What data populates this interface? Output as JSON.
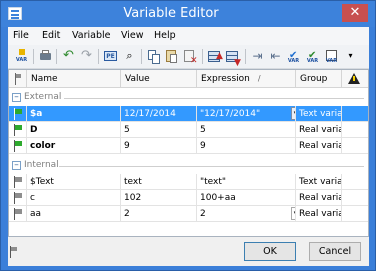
{
  "window": {
    "title": "Variable Editor",
    "close_glyph": "✕"
  },
  "menu": [
    "File",
    "Edit",
    "Variable",
    "View",
    "Help"
  ],
  "toolbar": {
    "var_label": "VAR",
    "icons": [
      "new-variable-icon",
      "print-icon",
      "undo-icon",
      "redo-icon",
      "property-editor-icon",
      "find-icon",
      "copy-icon",
      "paste-icon",
      "delete-icon",
      "move-up-icon",
      "move-down-icon",
      "insert-row-icon",
      "insert-after-icon",
      "var-check-icon",
      "var-export-icon",
      "toolbar-overflow-icon"
    ]
  },
  "grid": {
    "columns": {
      "name": "Name",
      "value": "Value",
      "expression": "Expression",
      "expression_sort": "/",
      "group": "Group"
    },
    "groups": [
      {
        "label": "External",
        "rows": [
          {
            "name": "$a",
            "value": "12/17/2014",
            "expression": "\"12/17/2014\"",
            "group": "Text variables",
            "bold": true,
            "selected": true,
            "flag": "green"
          },
          {
            "name": "D",
            "value": "5",
            "expression": "5",
            "group": "Real variables",
            "bold": true,
            "selected": false,
            "flag": "green"
          },
          {
            "name": "color",
            "value": "9",
            "expression": "9",
            "group": "Real variables",
            "bold": true,
            "selected": false,
            "flag": "green"
          }
        ]
      },
      {
        "label": "Internal",
        "rows": [
          {
            "name": "$Text",
            "value": "text",
            "expression": "\"text\"",
            "group": "Text variables",
            "bold": false,
            "selected": false,
            "flag": "gray"
          },
          {
            "name": "c",
            "value": "102",
            "expression": "100+aa",
            "group": "Real variables",
            "bold": false,
            "selected": false,
            "flag": "gray"
          },
          {
            "name": "aa",
            "value": "2",
            "expression": "2",
            "group": "Real variables",
            "bold": false,
            "selected": false,
            "flag": "gray"
          }
        ]
      }
    ]
  },
  "buttons": {
    "ok": "OK",
    "cancel": "Cancel"
  },
  "colors": {
    "titlebar": "#3d82db",
    "selection": "#3399ff",
    "flag_green": "#2eaa2e",
    "flag_gray": "#8e8e8e",
    "close_button": "#c75050"
  }
}
